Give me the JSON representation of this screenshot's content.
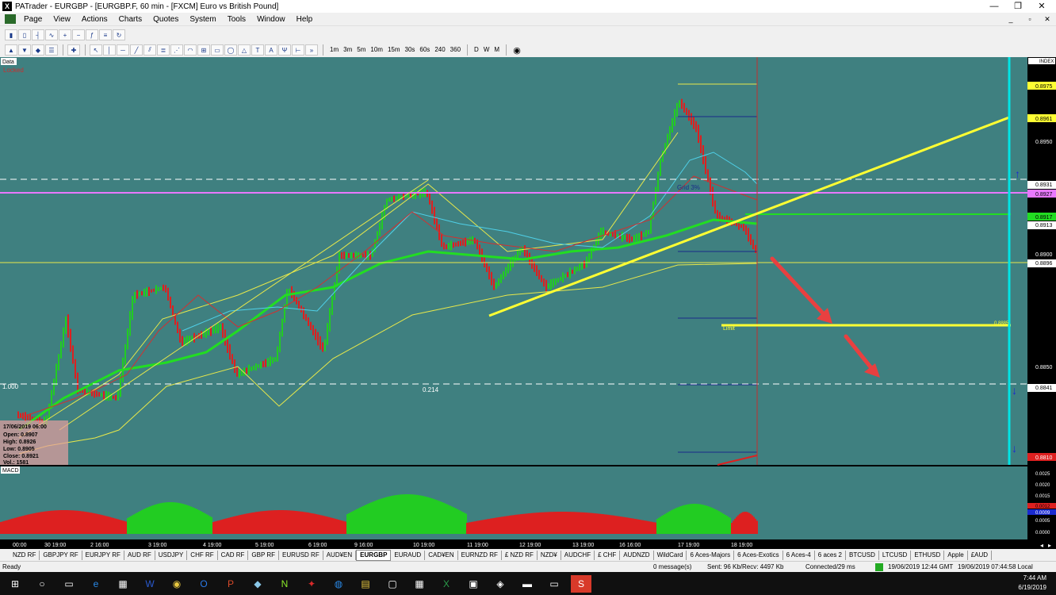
{
  "window": {
    "title": "PATrader - EURGBP - [EURGBP.F, 60 min - [FXCM] Euro vs British Pound]",
    "app_icon": "X",
    "minimize": "—",
    "restore": "❐",
    "close": "✕"
  },
  "menu": [
    "Page",
    "View",
    "Actions",
    "Charts",
    "Quotes",
    "System",
    "Tools",
    "Window",
    "Help"
  ],
  "timeframes": [
    "1m",
    "3m",
    "5m",
    "10m",
    "15m",
    "30s",
    "60s",
    "240",
    "360",
    "D",
    "W",
    "M"
  ],
  "chart": {
    "data_label": "Data",
    "locked_label": "Locked",
    "index_label": "INDEX",
    "price_labels": [
      "0.8975",
      "0.8961",
      "0.8950",
      "0.8931",
      "0.8927",
      "0.8917",
      "0.8913",
      "0.8900",
      "0.8896",
      "0.8850",
      "0.8841",
      "0.8810"
    ],
    "fib_left": "1.000",
    "fib_mid": "0.214",
    "grid_label": "Grid 3%",
    "limit_label": "Limit",
    "limit_price": "0.8885",
    "ohlc": {
      "date": "17/06/2019 06:00",
      "open": "Open: 0.8907",
      "high": "High: 0.8926",
      "low": "Low: 0.8905",
      "close": "Close: 0.8921",
      "vol": "Vol.: 1581"
    },
    "macd_label": "MACD",
    "macd_scale": [
      "0.0025",
      "0.0020",
      "0.0015",
      "0.0010",
      "0.0005",
      "0.0000"
    ],
    "macd_values": [
      "0.0012",
      "0.0009"
    ],
    "time_labels": [
      "00:00",
      "30 19:00",
      "2 16:00",
      "3 19:00",
      "4 19:00",
      "5 19:00",
      "6 19:00",
      "9 16:00",
      "10 19:00",
      "11 19:00",
      "12 19:00",
      "13 19:00",
      "16 16:00",
      "17 19:00",
      "18 19:00"
    ]
  },
  "tabs": [
    "NZD RF",
    "GBPJPY RF",
    "EURJPY RF",
    "AUD RF",
    "USDJPY",
    "CHF RF",
    "CAD RF",
    "GBP RF",
    "EURUSD RF",
    "AUD¥EN",
    "EURGBP",
    "EURAUD",
    "CAD¥EN",
    "EURNZD RF",
    "£ NZD RF",
    "NZD¥",
    "AUDCHF",
    "£ CHF",
    "AUDNZD",
    "WildCard",
    "6 Aces-Majors",
    "6 Aces-Exotics",
    "6 Aces-4",
    "6 aces 2",
    "BTCUSD",
    "LTCUSD",
    "ETHUSD",
    "Apple",
    "£AUD"
  ],
  "active_tab": "EURGBP",
  "status": {
    "ready": "Ready",
    "messages": "0 message(s)",
    "traffic": "Sent: 96 Kb/Recv: 4497 Kb",
    "connected": "Connected/29 ms",
    "date_info": "19/06/2019 12:44 GMT",
    "local": "19/06/2019 07:44:58 Local"
  },
  "taskbar": {
    "time": "7:44 AM",
    "date": "6/19/2019"
  },
  "colors": {
    "chart_bg": "#3f8080",
    "up_candle": "#22cc22",
    "down_candle": "#dd2020",
    "trend_line": "#ffff33",
    "target_arrow": "#e84040",
    "cyan": "#00e5e5"
  }
}
